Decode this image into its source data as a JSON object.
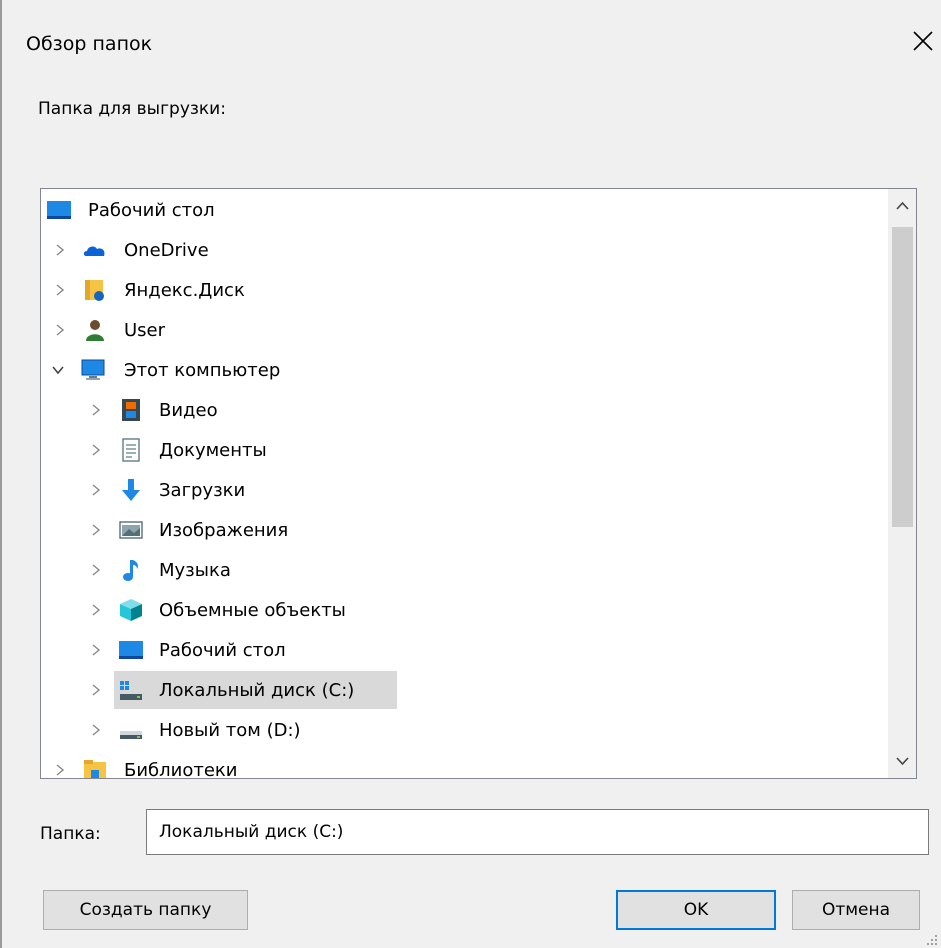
{
  "dialog": {
    "title": "Обзор папок",
    "prompt": "Папка для выгрузки:"
  },
  "tree": {
    "items": [
      {
        "label": "Рабочий стол",
        "icon": "desktop-icon",
        "level": 0,
        "expander": "none"
      },
      {
        "label": "OneDrive",
        "icon": "onedrive-cloud-icon",
        "level": 1,
        "expander": "collapsed"
      },
      {
        "label": "Яндекс.Диск",
        "icon": "yandex-disk-folder-icon",
        "level": 1,
        "expander": "collapsed"
      },
      {
        "label": "User",
        "icon": "user-icon",
        "level": 1,
        "expander": "collapsed"
      },
      {
        "label": "Этот компьютер",
        "icon": "this-pc-icon",
        "level": 1,
        "expander": "expanded"
      },
      {
        "label": "Видео",
        "icon": "video-icon",
        "level": 2,
        "expander": "collapsed"
      },
      {
        "label": "Документы",
        "icon": "documents-icon",
        "level": 2,
        "expander": "collapsed"
      },
      {
        "label": "Загрузки",
        "icon": "downloads-icon",
        "level": 2,
        "expander": "collapsed"
      },
      {
        "label": "Изображения",
        "icon": "pictures-icon",
        "level": 2,
        "expander": "collapsed"
      },
      {
        "label": "Музыка",
        "icon": "music-icon",
        "level": 2,
        "expander": "collapsed"
      },
      {
        "label": "Объемные объекты",
        "icon": "3d-objects-icon",
        "level": 2,
        "expander": "collapsed"
      },
      {
        "label": "Рабочий стол",
        "icon": "desktop-icon",
        "level": 2,
        "expander": "collapsed"
      },
      {
        "label": "Локальный диск (C:)",
        "icon": "system-drive-icon",
        "level": 2,
        "expander": "collapsed",
        "selected": true
      },
      {
        "label": "Новый том (D:)",
        "icon": "drive-icon",
        "level": 2,
        "expander": "collapsed"
      },
      {
        "label": "Библиотеки",
        "icon": "libraries-icon",
        "level": 1,
        "expander": "collapsed"
      }
    ]
  },
  "folder": {
    "label": "Папка:",
    "value": "Локальный диск (C:)"
  },
  "buttons": {
    "create_folder": "Создать папку",
    "ok": "OK",
    "cancel": "Отмена"
  },
  "colors": {
    "accent": "#0078d7",
    "selection": "#d9d9d9"
  }
}
